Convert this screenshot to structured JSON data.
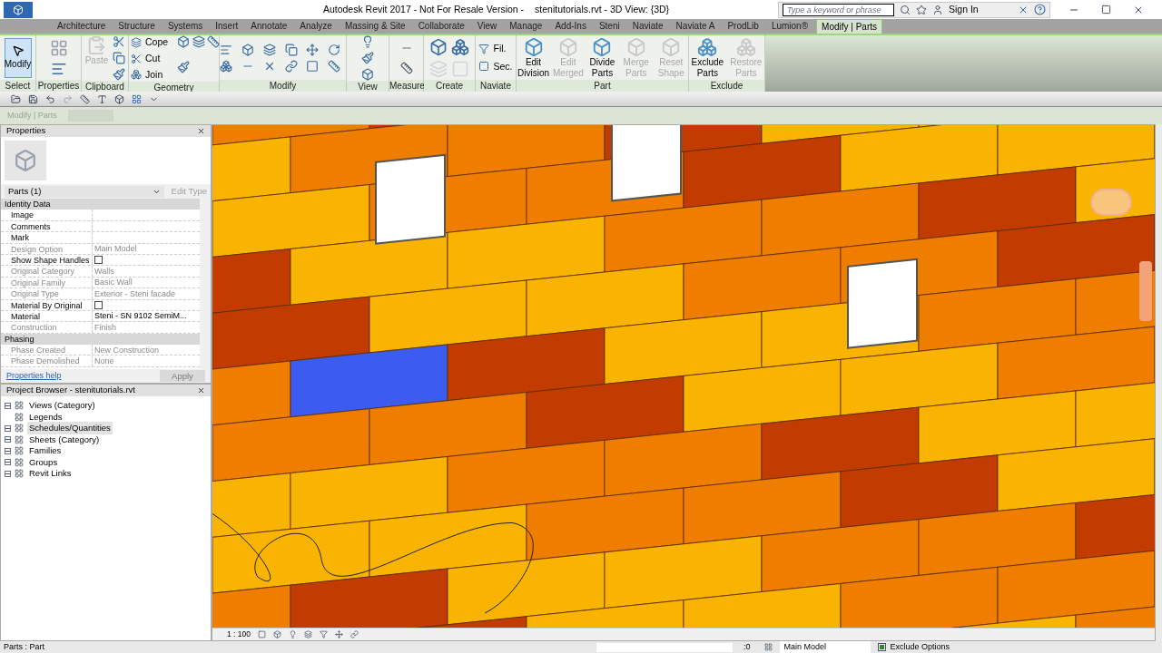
{
  "app_title": "Autodesk Revit 2017 - Not For Resale Version -",
  "document_title": "stenitutorials.rvt - 3D View: {3D}",
  "search": {
    "placeholder": "Type a keyword or phrase"
  },
  "sign_in": "Sign In",
  "tabs": [
    {
      "label": "Architecture",
      "selected": false
    },
    {
      "label": "Structure",
      "selected": false
    },
    {
      "label": "Systems",
      "selected": false
    },
    {
      "label": "Insert",
      "selected": false
    },
    {
      "label": "Annotate",
      "selected": false
    },
    {
      "label": "Analyze",
      "selected": false
    },
    {
      "label": "Massing & Site",
      "selected": false
    },
    {
      "label": "Collaborate",
      "selected": false
    },
    {
      "label": "View",
      "selected": false
    },
    {
      "label": "Manage",
      "selected": false
    },
    {
      "label": "Add-Ins",
      "selected": false
    },
    {
      "label": "Steni",
      "selected": false
    },
    {
      "label": "Naviate",
      "selected": false
    },
    {
      "label": "Naviate A",
      "selected": false
    },
    {
      "label": "ProdLib",
      "selected": false
    },
    {
      "label": "Lumion®",
      "selected": false
    },
    {
      "label": "Modify | Parts",
      "selected": true
    }
  ],
  "ribbon": [
    {
      "kind": "select",
      "label": "Select",
      "tools": [
        {
          "label": "Modify",
          "disabled": false
        }
      ]
    },
    {
      "kind": "properties",
      "label": "Properties"
    },
    {
      "kind": "clipboard",
      "label": "Clipboard",
      "tools": [
        {
          "label": "Paste",
          "disabled": true
        }
      ]
    },
    {
      "kind": "geometry",
      "label": "Geometry",
      "tools": [
        {
          "label": "Cope",
          "disabled": false
        },
        {
          "label": "Cut",
          "disabled": false
        },
        {
          "label": "Join",
          "disabled": false
        }
      ]
    },
    {
      "kind": "modify",
      "label": "Modify"
    },
    {
      "kind": "view",
      "label": "View"
    },
    {
      "kind": "measure",
      "label": "Measure"
    },
    {
      "kind": "create",
      "label": "Create"
    },
    {
      "kind": "naviate",
      "label": "Naviate",
      "tools": [
        {
          "label": "Fil.",
          "disabled": false
        },
        {
          "label": "Sec.",
          "disabled": false
        }
      ]
    },
    {
      "kind": "part",
      "label": "Part",
      "tools": [
        {
          "label": "Edit Division",
          "disabled": false
        },
        {
          "label": "Edit Merged",
          "disabled": true
        },
        {
          "label": "Divide Parts",
          "disabled": false
        },
        {
          "label": "Merge Parts",
          "disabled": true
        },
        {
          "label": "Reset Shape",
          "disabled": true
        }
      ]
    },
    {
      "kind": "exclude",
      "label": "Exclude",
      "tools": [
        {
          "label": "Exclude Parts",
          "disabled": false
        },
        {
          "label": "Restore Parts",
          "disabled": true
        }
      ]
    }
  ],
  "options_bar": {
    "label": "Modify | Parts"
  },
  "properties": {
    "title": "Properties",
    "type_selector": "Parts (1)",
    "edit_type": {
      "label": "Edit Type",
      "disabled": true
    },
    "groups": [
      {
        "name": "Identity Data",
        "rows": [
          {
            "name": "Image",
            "kind": "text",
            "value": "",
            "disabled": false
          },
          {
            "name": "Comments",
            "kind": "text",
            "value": "",
            "disabled": false
          },
          {
            "name": "Mark",
            "kind": "text",
            "value": "",
            "disabled": false
          },
          {
            "name": "Design Option",
            "kind": "text",
            "value": "Main Model",
            "disabled": true
          },
          {
            "name": "Show Shape Handles",
            "kind": "checkbox",
            "checked": false,
            "disabled": false
          },
          {
            "name": "Original Category",
            "kind": "text",
            "value": "Walls",
            "disabled": true
          },
          {
            "name": "Original Family",
            "kind": "text",
            "value": "Basic Wall",
            "disabled": true
          },
          {
            "name": "Original Type",
            "kind": "text",
            "value": "Exterior - Steni facade",
            "disabled": true
          },
          {
            "name": "Material By Original",
            "kind": "checkbox",
            "checked": false,
            "disabled": false
          },
          {
            "name": "Material",
            "kind": "text",
            "value": "Steni - SN 9102 SemiM...",
            "disabled": false
          },
          {
            "name": "Construction",
            "kind": "text",
            "value": "Finish",
            "disabled": true
          }
        ]
      },
      {
        "name": "Phasing",
        "rows": [
          {
            "name": "Phase Created",
            "kind": "text",
            "value": "New Construction",
            "disabled": true
          },
          {
            "name": "Phase Demolished",
            "kind": "text",
            "value": "None",
            "disabled": true
          }
        ]
      }
    ],
    "help_link": "Properties help",
    "apply": {
      "label": "Apply",
      "disabled": true
    }
  },
  "project_browser": {
    "title": "Project Browser - stenitutorials.rvt",
    "items": [
      {
        "label": "Views (Category)",
        "expandable": true,
        "selected": false
      },
      {
        "label": "Legends",
        "expandable": false,
        "selected": false
      },
      {
        "label": "Schedules/Quantities",
        "expandable": true,
        "selected": true
      },
      {
        "label": "Sheets (Category)",
        "expandable": true,
        "selected": false
      },
      {
        "label": "Families",
        "expandable": true,
        "selected": false
      },
      {
        "label": "Groups",
        "expandable": true,
        "selected": false
      },
      {
        "label": "Revit Links",
        "expandable": true,
        "selected": false
      }
    ]
  },
  "view_bar": {
    "scale": "1 : 100"
  },
  "status_bar": {
    "selection": "Parts : Part",
    "filter_count": ":0",
    "design_option": "Main Model",
    "exclude_options": {
      "label": "Exclude Options",
      "checked": true
    }
  }
}
